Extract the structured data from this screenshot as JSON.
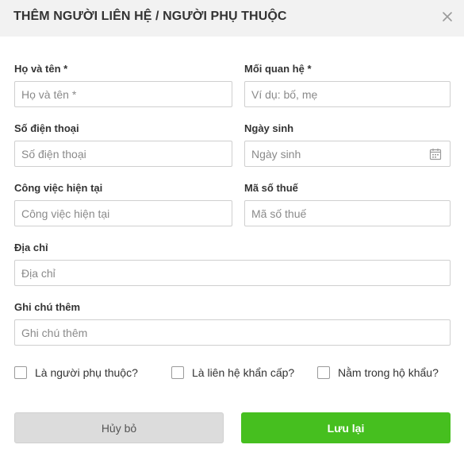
{
  "dialog": {
    "title": "THÊM NGƯỜI LIÊN HỆ / NGƯỜI PHỤ THUỘC"
  },
  "fields": {
    "full_name": {
      "label": "Họ và tên *",
      "placeholder": "Họ và tên *",
      "value": ""
    },
    "relationship": {
      "label": "Mối quan hệ *",
      "placeholder": "Ví dụ: bố, mẹ",
      "value": ""
    },
    "phone": {
      "label": "Số điện thoại",
      "placeholder": "Số điện thoại",
      "value": ""
    },
    "birthday": {
      "label": "Ngày sinh",
      "placeholder": "Ngày sinh",
      "value": ""
    },
    "job": {
      "label": "Công việc hiện tại",
      "placeholder": "Công việc hiện tại",
      "value": ""
    },
    "tax_code": {
      "label": "Mã số thuế",
      "placeholder": "Mã số thuế",
      "value": ""
    },
    "address": {
      "label": "Địa chỉ",
      "placeholder": "Địa chỉ",
      "value": ""
    },
    "note": {
      "label": "Ghi chú thêm",
      "placeholder": "Ghi chú thêm",
      "value": ""
    }
  },
  "checkboxes": {
    "dependent": {
      "label": "Là người phụ thuộc?",
      "checked": false
    },
    "emergency": {
      "label": "Là liên hệ khẩn cấp?",
      "checked": false
    },
    "household": {
      "label": "Nằm trong hộ khẩu?",
      "checked": false
    }
  },
  "buttons": {
    "cancel": "Hủy bỏ",
    "save": "Lưu lại"
  },
  "icons": {
    "close": "close-icon",
    "calendar": "calendar-icon"
  },
  "colors": {
    "header_bg": "#f2f2f2",
    "save_button": "#46bf1f",
    "cancel_button": "#dcdcdc"
  }
}
